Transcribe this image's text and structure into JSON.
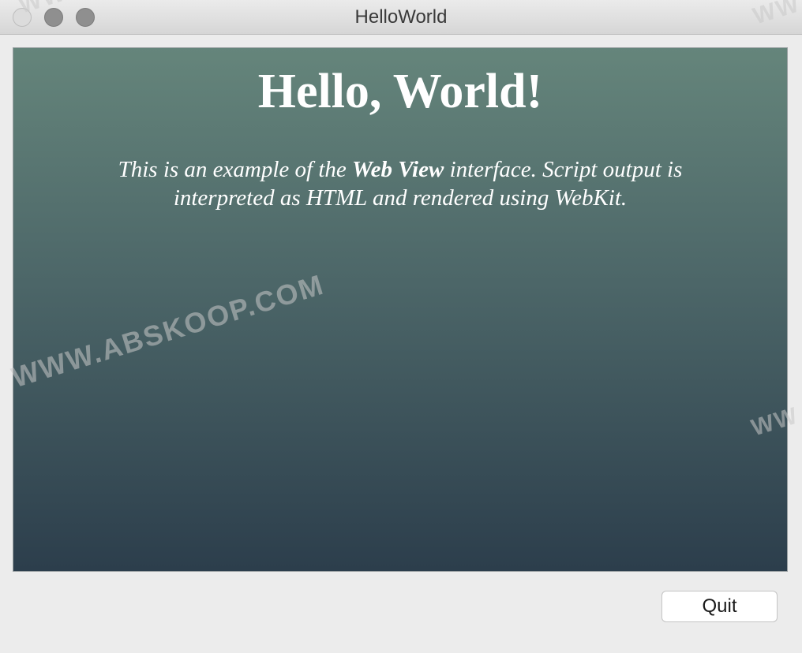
{
  "window": {
    "title": "HelloWorld"
  },
  "webview": {
    "heading": "Hello, World!",
    "paragraph": {
      "part1": "This is an example of the ",
      "bold": "Web View",
      "part2": " interface. Script output is interpreted as HTML and rendered using WebKit."
    }
  },
  "buttons": {
    "quit_label": "Quit"
  },
  "watermark": {
    "text": "WWW.ABSKOOP.COM",
    "fragment": "WW"
  },
  "colors": {
    "gradient_top": "#65857b",
    "gradient_bottom": "#2c3e4c",
    "text_on_view": "#ffffff"
  }
}
